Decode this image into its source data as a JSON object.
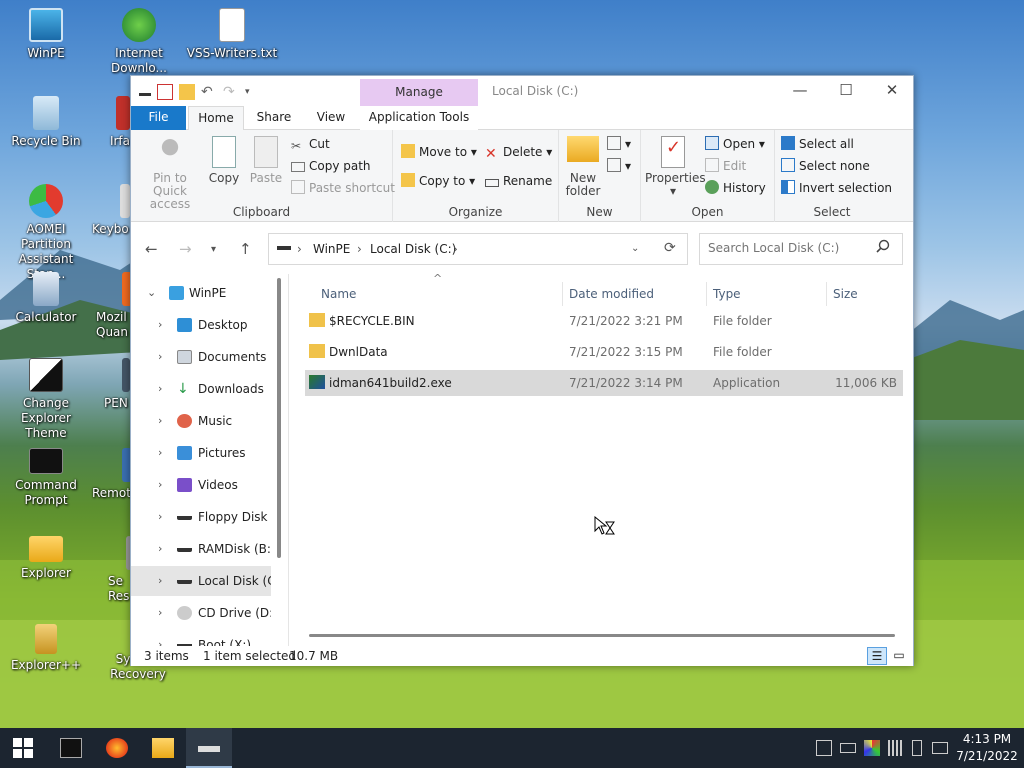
{
  "desktop": {
    "icons": [
      {
        "label": "WinPE"
      },
      {
        "label": "Internet Downlo..."
      },
      {
        "label": "VSS-Writers.txt"
      },
      {
        "label": "Recycle Bin"
      },
      {
        "label": "Irfa"
      },
      {
        "label": "AOMEI Partition Assistant Stan..."
      },
      {
        "label": "Keybo"
      },
      {
        "label": "Calculator"
      },
      {
        "label": "Mozil Quan"
      },
      {
        "label": "Change Explorer Theme"
      },
      {
        "label": "PEN"
      },
      {
        "label": "Command Prompt"
      },
      {
        "label": "Remot"
      },
      {
        "label": "Explorer"
      },
      {
        "label": "Se Res"
      },
      {
        "label": "Explorer++"
      },
      {
        "label": "System Recovery"
      }
    ]
  },
  "window": {
    "title": "Local Disk (C:)",
    "manage_tab": "Manage",
    "tabs": {
      "file": "File",
      "home": "Home",
      "share": "Share",
      "view": "View",
      "app_tools": "Application Tools"
    },
    "help": "?"
  },
  "ribbon": {
    "clipboard": {
      "name": "Clipboard",
      "pin": "Pin to Quick access",
      "copy": "Copy",
      "paste": "Paste",
      "cut": "Cut",
      "copy_path": "Copy path",
      "paste_shortcut": "Paste shortcut"
    },
    "organize": {
      "name": "Organize",
      "move_to": "Move to",
      "copy_to": "Copy to",
      "delete": "Delete",
      "rename": "Rename"
    },
    "new": {
      "name": "New",
      "new_folder": "New folder"
    },
    "open": {
      "name": "Open",
      "properties": "Properties",
      "open": "Open",
      "edit": "Edit",
      "history": "History"
    },
    "select": {
      "name": "Select",
      "select_all": "Select all",
      "select_none": "Select none",
      "invert": "Invert selection"
    }
  },
  "address": {
    "crumbs": [
      "WinPE",
      "Local Disk (C:)"
    ],
    "search_placeholder": "Search Local Disk (C:)"
  },
  "nav": {
    "items": [
      {
        "label": "WinPE"
      },
      {
        "label": "Desktop"
      },
      {
        "label": "Documents"
      },
      {
        "label": "Downloads"
      },
      {
        "label": "Music"
      },
      {
        "label": "Pictures"
      },
      {
        "label": "Videos"
      },
      {
        "label": "Floppy Disk D"
      },
      {
        "label": "RAMDisk (B:)"
      },
      {
        "label": "Local Disk (C:"
      },
      {
        "label": "CD Drive (D:)"
      },
      {
        "label": "Boot (X:)"
      }
    ]
  },
  "files": {
    "columns": {
      "name": "Name",
      "date": "Date modified",
      "type": "Type",
      "size": "Size"
    },
    "rows": [
      {
        "name": "$RECYCLE.BIN",
        "date": "7/21/2022 3:21 PM",
        "type": "File folder",
        "size": ""
      },
      {
        "name": "DwnlData",
        "date": "7/21/2022 3:15 PM",
        "type": "File folder",
        "size": ""
      },
      {
        "name": "idman641build2.exe",
        "date": "7/21/2022 3:14 PM",
        "type": "Application",
        "size": "11,006 KB"
      }
    ]
  },
  "status": {
    "items": "3 items",
    "selected": "1 item selected",
    "size": "10.7 MB"
  },
  "taskbar": {
    "time": "4:13 PM",
    "date": "7/21/2022"
  },
  "colors": {
    "accent": "#1979ca",
    "manage_tab": "#e7c9f2",
    "selection": "#d9d9d9",
    "taskbar": "#1c2530"
  }
}
